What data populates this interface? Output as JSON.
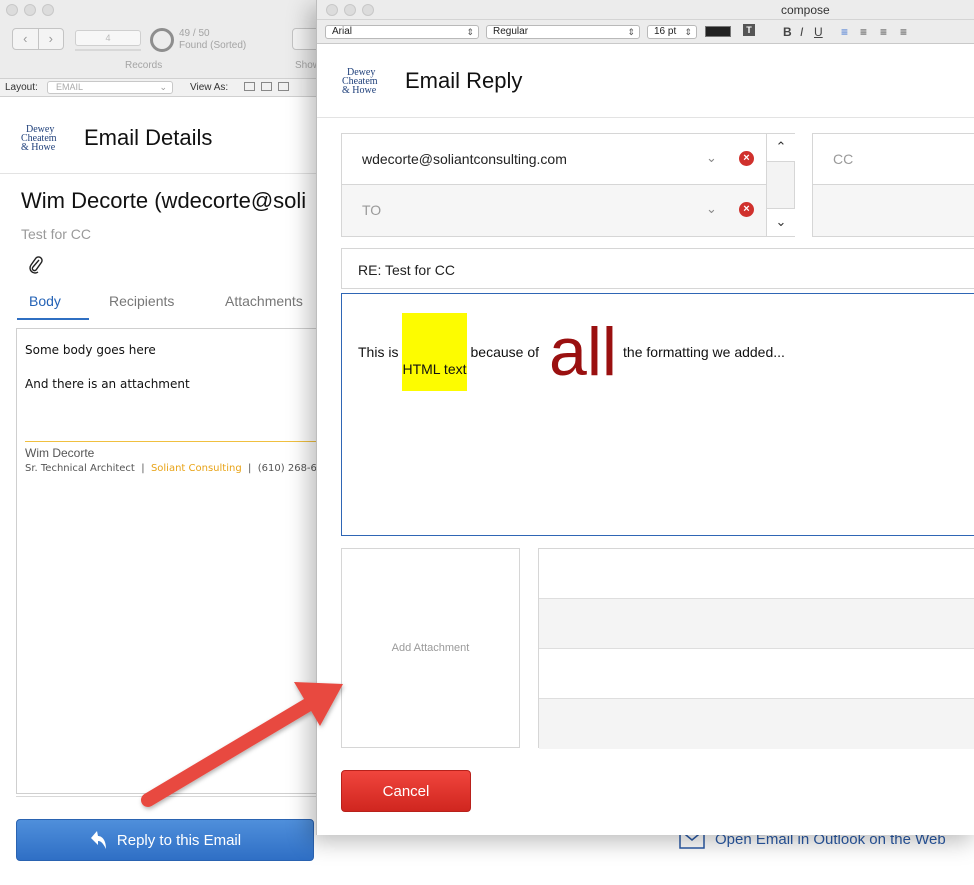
{
  "back_window": {
    "records_current": "4",
    "records_count": "49 / 50",
    "records_status": "Found (Sorted)",
    "records_label": "Records",
    "show_label": "Show",
    "layout_label": "Layout:",
    "layout_value": "EMAIL",
    "view_as_label": "View As:",
    "logo_lines": [
      "Dewey",
      "Cheatem",
      "& Howe"
    ],
    "title": "Email Details",
    "sender": "Wim Decorte (wdecorte@soli",
    "subject": "Test for CC",
    "tabs": [
      {
        "label": "Body"
      },
      {
        "label": "Recipients"
      },
      {
        "label": "Attachments"
      }
    ],
    "body_lines": [
      "Some body goes here",
      "And there is an attachment"
    ],
    "signature": {
      "name": "Wim Decorte",
      "role": "Sr. Technical Architect",
      "company": "Soliant Consulting",
      "phone": "(610) 268-6"
    },
    "reply_button": "Reply to this Email",
    "outlook_link": "Open Email in Outlook on the Web"
  },
  "compose_window": {
    "window_title": "compose",
    "format_bar": {
      "font": "Arial",
      "style": "Regular",
      "size": "16 pt",
      "text_color": "#222222"
    },
    "logo_lines": [
      "Dewey",
      "Cheatem",
      "& Howe"
    ],
    "title": "Email Reply",
    "to_rows": [
      {
        "value": "wdecorte@soliantconsulting.com",
        "placeholder": ""
      },
      {
        "value": "",
        "placeholder": "TO"
      }
    ],
    "cc_placeholder": "CC",
    "subject": "RE: Test for CC",
    "body": {
      "part1": "This is",
      "highlight": "HTML text",
      "part2": "because of",
      "big_word": "all",
      "part3": "the formatting we added..."
    },
    "add_attachment": "Add Attachment",
    "cancel_button": "Cancel"
  },
  "colors": {
    "accent_blue": "#2f6fc2",
    "cancel_red": "#d0261f",
    "highlight_yellow": "#fdfc00",
    "big_word_red": "#9a1010",
    "signature_company": "#e8a317",
    "arrow_red": "#e8483f"
  },
  "icons": [
    "paperclip-icon",
    "reply-arrow-icon",
    "envelope-icon",
    "remove-recipient-icon",
    "chevron-down-icon",
    "scroll-up-icon",
    "scroll-down-icon"
  ]
}
